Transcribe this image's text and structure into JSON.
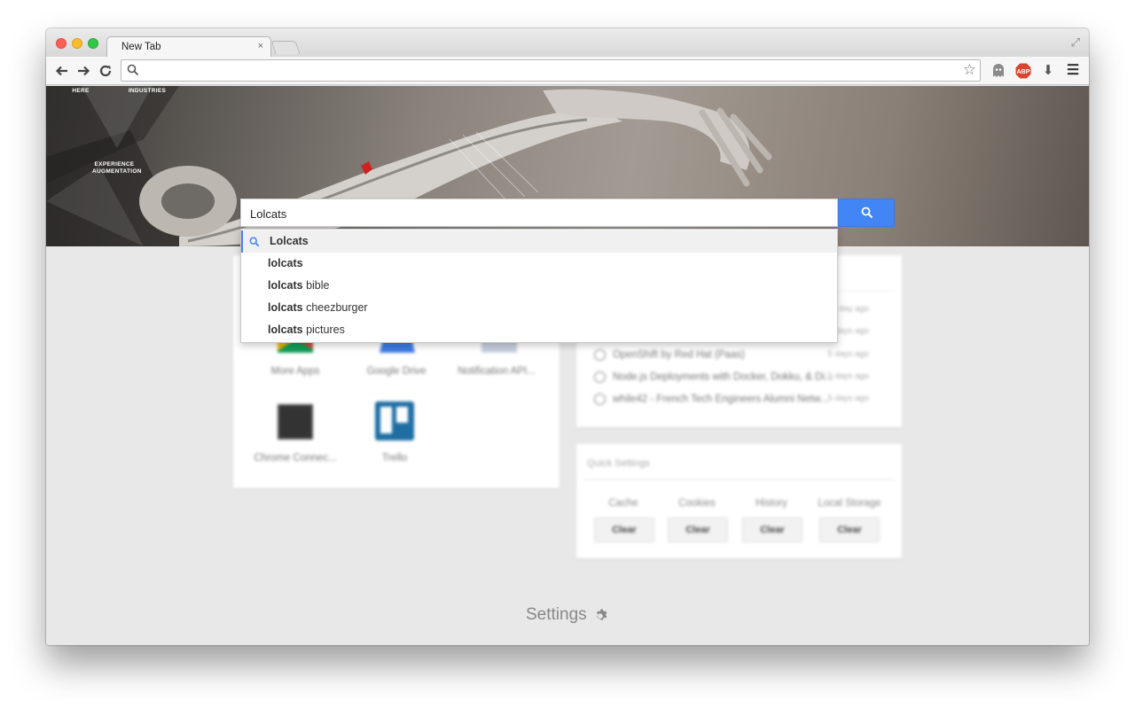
{
  "browser": {
    "tab_title": "New Tab",
    "tab_close": "×",
    "omnibox_value": "",
    "abp_label": "ABP"
  },
  "hero": {
    "labels": [
      "HERE",
      "INDUSTRIES",
      "EXPERIENCE AUGMENTATION"
    ]
  },
  "search": {
    "query": "Lolcats",
    "suggestions": [
      {
        "bold": "Lolcats",
        "rest": ""
      },
      {
        "bold": "lolcats",
        "rest": ""
      },
      {
        "bold": "lolcats",
        "rest": " bible"
      },
      {
        "bold": "lolcats",
        "rest": " cheezburger"
      },
      {
        "bold": "lolcats",
        "rest": " pictures"
      }
    ]
  },
  "apps": [
    {
      "label": "More Apps"
    },
    {
      "label": "Google Drive"
    },
    {
      "label": "Notification API..."
    },
    {
      "label": "Chrome Connec..."
    },
    {
      "label": "Trello"
    }
  ],
  "history": [
    {
      "title": "",
      "time": "a day ago"
    },
    {
      "title": "",
      "time": "5 days ago"
    },
    {
      "title": "OpenShift by Red Hat (Paas)",
      "time": "5 days ago"
    },
    {
      "title": "Node.js Deployments with Docker, Dokku, & Di...",
      "time": "5 days ago"
    },
    {
      "title": "while42 - French Tech Engineers Alumni Netw...",
      "time": "5 days ago"
    }
  ],
  "quick_settings": {
    "title": "Quick Settings",
    "columns": [
      {
        "label": "Cache",
        "button": "Clear"
      },
      {
        "label": "Cookies",
        "button": "Clear"
      },
      {
        "label": "History",
        "button": "Clear"
      },
      {
        "label": "Local Storage",
        "button": "Clear"
      }
    ]
  },
  "footer": {
    "settings_label": "Settings"
  },
  "colors": {
    "accent": "#4285f4",
    "abp_red": "#d8442f"
  }
}
